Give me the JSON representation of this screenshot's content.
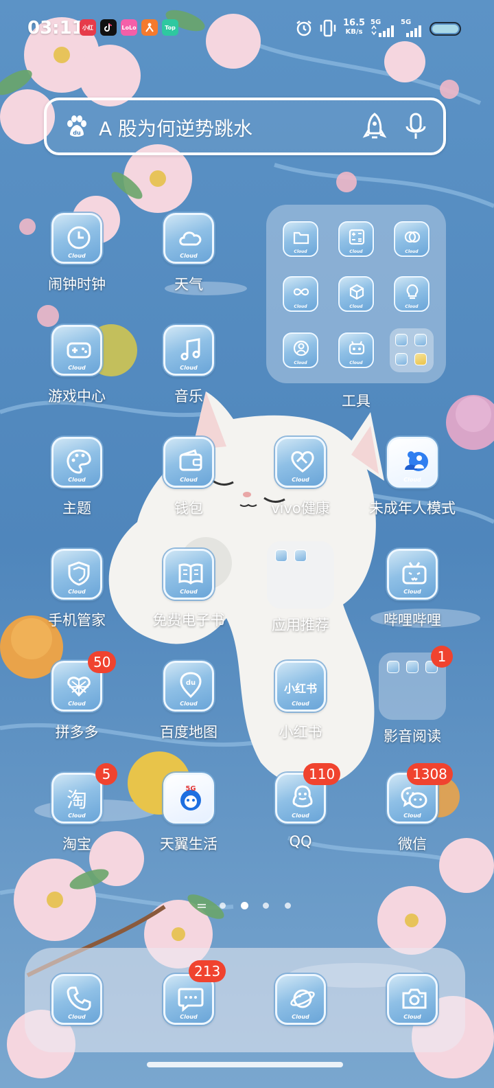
{
  "status_bar": {
    "time": "03:11",
    "notification_icons": [
      "news-app-icon",
      "tiktok-icon",
      "lele-app-icon",
      "person-app-icon",
      "top-app-icon"
    ],
    "notif_texts": [
      "小红",
      "",
      "LoLo",
      "",
      "Top"
    ],
    "net_speed_value": "16.5",
    "net_speed_unit": "KB/s",
    "sim1_label": "5G",
    "sim2_label": "5G"
  },
  "search": {
    "query": "A 股为何逆势跳水"
  },
  "apps": [
    {
      "name": "闹钟时钟",
      "icon": "clock-icon"
    },
    {
      "name": "天气",
      "icon": "cloud-icon"
    },
    {
      "name": "游戏中心",
      "icon": "gamepad-icon"
    },
    {
      "name": "音乐",
      "icon": "music-note-icon"
    },
    {
      "name": "主题",
      "icon": "palette-icon"
    },
    {
      "name": "钱包",
      "icon": "wallet-icon"
    },
    {
      "name": "vivo健康",
      "icon": "heart-icon"
    },
    {
      "name": "未成年人模式",
      "icon": "family-icon"
    },
    {
      "name": "手机管家",
      "icon": "shield-icon"
    },
    {
      "name": "免费电子书",
      "icon": "book-icon"
    },
    {
      "name": "哔哩哔哩",
      "icon": "tv-icon"
    },
    {
      "name": "拼多多",
      "icon": "pinduoduo-icon",
      "badge": "50"
    },
    {
      "name": "百度地图",
      "icon": "map-pin-icon"
    },
    {
      "name": "小红书",
      "icon": "xiaohongshu-icon",
      "text": "小红书"
    },
    {
      "name": "淘宝",
      "icon": "taobao-icon",
      "text": "淘",
      "badge": "5"
    },
    {
      "name": "天翼生活",
      "icon": "tianyi-icon",
      "text": "5G"
    },
    {
      "name": "QQ",
      "icon": "penguin-icon",
      "badge": "110"
    },
    {
      "name": "微信",
      "icon": "wechat-icon",
      "badge": "1308"
    }
  ],
  "folders": {
    "tools": {
      "name": "工具"
    },
    "recommend": {
      "name": "应用推荐"
    },
    "media": {
      "name": "影音阅读",
      "badge": "1"
    }
  },
  "icon_caption": "Cloud",
  "dock": [
    {
      "icon": "phone-icon"
    },
    {
      "icon": "message-icon",
      "badge": "213"
    },
    {
      "icon": "browser-icon"
    },
    {
      "icon": "camera-icon"
    }
  ],
  "pager": {
    "pages": 4,
    "active_index": 1
  }
}
